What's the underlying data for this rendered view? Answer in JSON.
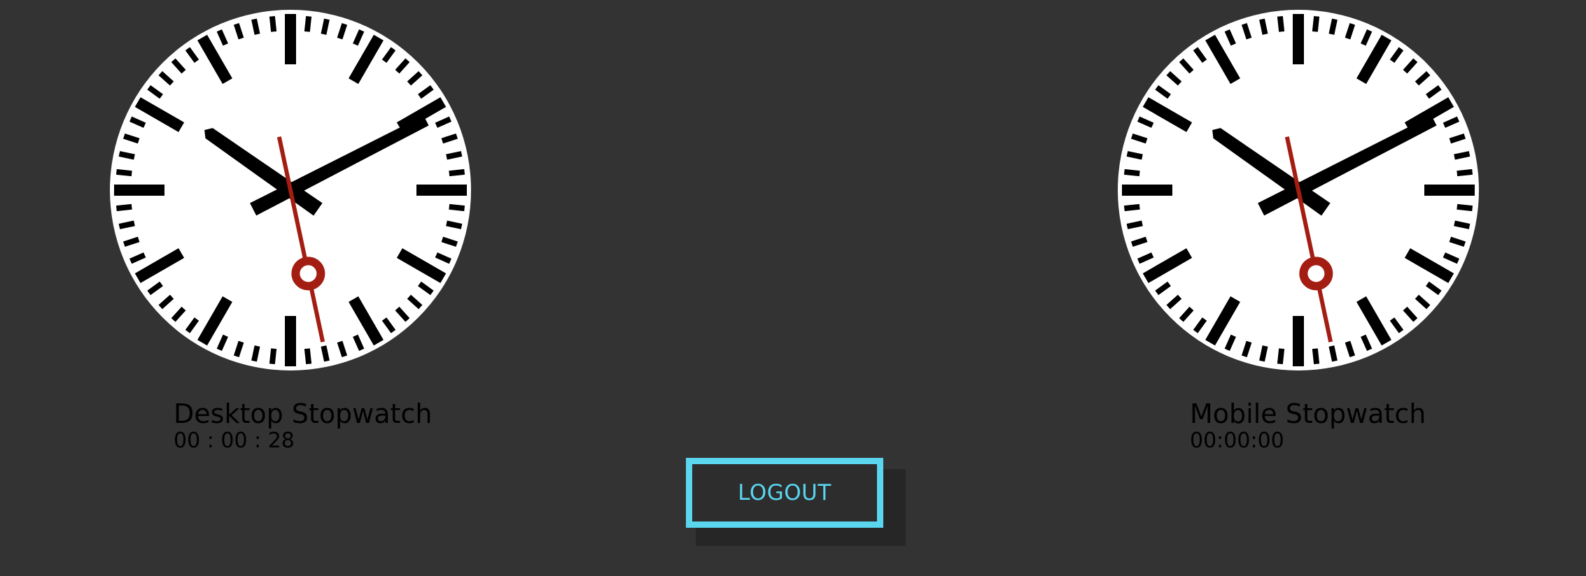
{
  "clocks": [
    {
      "id": "desktop",
      "title": "Desktop Stopwatch",
      "time": "00 : 00 : 28",
      "hands": {
        "hour": 10,
        "minute": 10,
        "second": 28
      }
    },
    {
      "id": "mobile",
      "title": "Mobile Stopwatch",
      "time": "00:00:00",
      "hands": {
        "hour": 10,
        "minute": 10,
        "second": 28
      }
    }
  ],
  "logout": {
    "label": "LOGOUT"
  },
  "colors": {
    "background": "#333333",
    "clock_face": "#ffffff",
    "ticks_and_hands": "#000000",
    "second_hand": "#a31d12",
    "accent": "#5ad6ef"
  }
}
